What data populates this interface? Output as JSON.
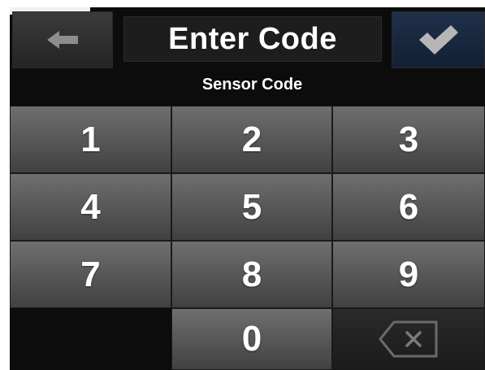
{
  "header": {
    "title": "Enter Code",
    "back_icon": "arrow-left-icon",
    "confirm_icon": "checkmark-icon"
  },
  "subtitle": "Sensor Code",
  "keypad": {
    "keys": [
      "1",
      "2",
      "3",
      "4",
      "5",
      "6",
      "7",
      "8",
      "9",
      "0"
    ],
    "backspace_icon": "backspace-icon"
  },
  "colors": {
    "background": "#0c0c0c",
    "key_face": "#5a5a5a",
    "confirm_button": "#1a2a40",
    "text": "#ffffff"
  }
}
